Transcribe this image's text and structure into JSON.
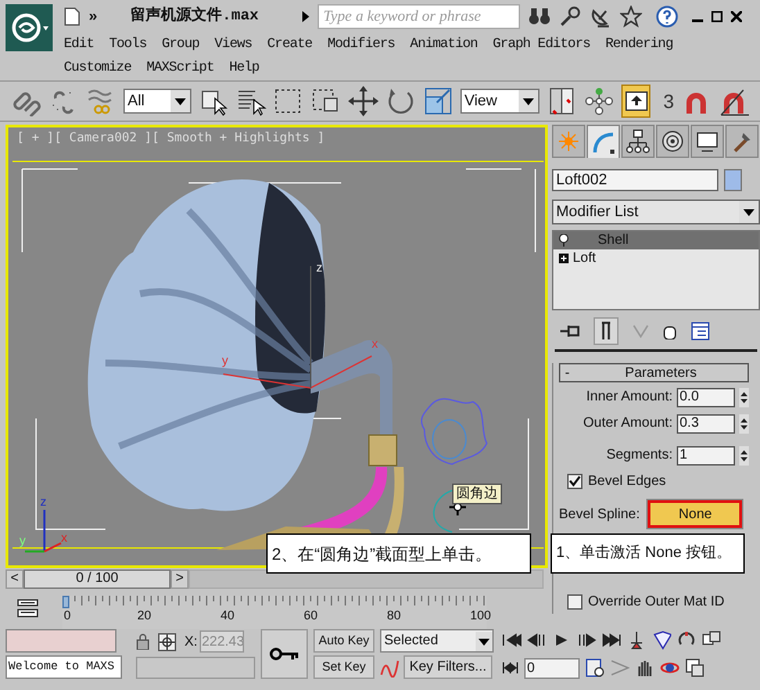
{
  "title_bar": {
    "title": "留声机源文件.max",
    "overflow": "»",
    "search": {
      "placeholder": "Type a keyword or phrase"
    }
  },
  "menu": [
    {
      "label": "Edit"
    },
    {
      "label": "Tools"
    },
    {
      "label": "Group"
    },
    {
      "label": "Views"
    },
    {
      "label": "Create"
    },
    {
      "label": "Modifiers"
    },
    {
      "label": "Animation"
    },
    {
      "label": "Graph Editors"
    },
    {
      "label": "Rendering"
    },
    {
      "label": "Customize"
    },
    {
      "label": "MAXScript"
    },
    {
      "label": "Help"
    }
  ],
  "toolbar": {
    "selection_filter": "All",
    "reference_system": "View",
    "snap_label": "3",
    "manipulate_active": true
  },
  "viewport": {
    "label": "[ + ][ Camera002 ][ Smooth + Highlights ]",
    "tooltip": "圆角边",
    "gizmo_axes": [
      "y",
      "x",
      "z"
    ],
    "corner_axes": [
      "z",
      "y",
      "x"
    ]
  },
  "command_panel": {
    "tabs": [
      {
        "selected": false
      },
      {
        "selected": true
      },
      {
        "selected": false
      },
      {
        "selected": false
      },
      {
        "selected": false
      },
      {
        "selected": false
      }
    ],
    "object_name": "Loft002",
    "modifier_list": "Modifier List",
    "stack": [
      {
        "label": "Shell",
        "selected": true,
        "expandable": false
      },
      {
        "label": "Loft",
        "selected": false,
        "expandable": true
      }
    ],
    "rollout": {
      "collapse": "-",
      "title": "Parameters",
      "fields": [
        {
          "kind": "spinner",
          "label": "Inner Amount:",
          "value": "0.0",
          "disabled": false
        },
        {
          "kind": "spinner",
          "label": "Outer Amount:",
          "value": "0.3",
          "disabled": false
        },
        {
          "kind": "spinner",
          "label": "Segments:",
          "value": "1",
          "disabled": false
        },
        {
          "kind": "checkbox",
          "label": "Bevel Edges",
          "checked": true
        },
        {
          "kind": "pick",
          "label": "Bevel Spline:",
          "value": "None",
          "active": true
        },
        {
          "kind": "checkbox",
          "label": "Override Outer Mat ID",
          "checked": false
        }
      ]
    }
  },
  "callouts": [
    {
      "text": "2、在“圆角边”截面型上单击。"
    },
    {
      "text": "1、单击激活 None 按钮。"
    }
  ],
  "time_slider": {
    "prev": "<",
    "position": "0 / 100",
    "next": ">"
  },
  "track_bar": {
    "labels": [
      "0",
      "20",
      "40",
      "60",
      "80",
      "100"
    ]
  },
  "status_bar": {
    "prompt": "Welcome to MAXS",
    "x_label": "X:",
    "x_value": "222.43",
    "auto_key": "Auto Key",
    "set_key": "Set Key",
    "key_mode": "Selected",
    "key_filters": "Key Filters...",
    "frame": "0"
  }
}
